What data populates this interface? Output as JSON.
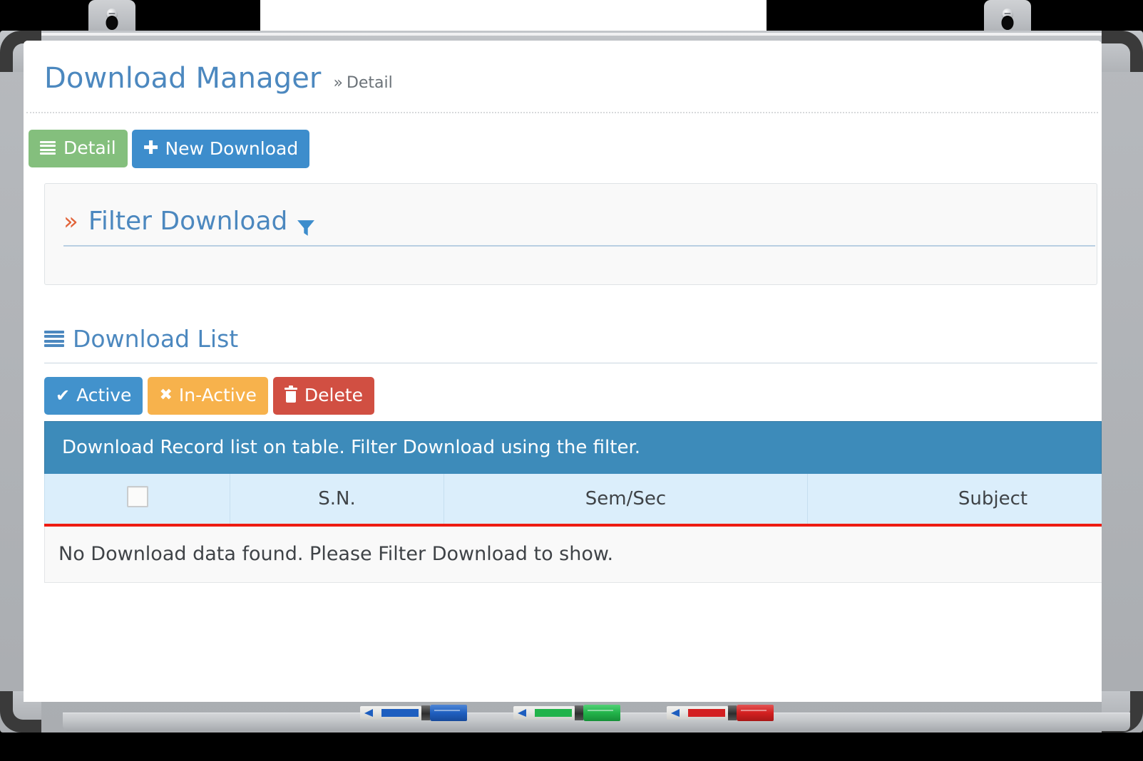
{
  "header": {
    "title": "Download Manager",
    "breadcrumb_chevron": "»",
    "breadcrumb": "Detail"
  },
  "toolbar": {
    "detail_label": "Detail",
    "detail_icon": "list-icon",
    "detail_color": "#84bf7d",
    "new_download_label": "New Download",
    "new_download_icon": "plus-icon",
    "new_download_color": "#3d8dcc"
  },
  "filter_panel": {
    "chevron": "»",
    "title": "Filter Download",
    "icon": "funnel-icon",
    "title_color": "#4c88bf",
    "chevron_color": "#e2643a"
  },
  "list_section": {
    "heading": "Download List",
    "heading_icon": "list-icon",
    "actions": [
      {
        "label": "Active",
        "icon": "check-icon",
        "color": "#4292cc"
      },
      {
        "label": "In-Active",
        "icon": "x-icon",
        "color": "#f7b24c"
      },
      {
        "label": "Delete",
        "icon": "trash-icon",
        "color": "#d14f42"
      }
    ],
    "info_bar": "Download Record list on table. Filter Download using the filter.",
    "info_bar_color": "#3d8bba"
  },
  "table": {
    "select_all_checkbox_checked": false,
    "columns": [
      "",
      "S.N.",
      "Sem/Sec",
      "Subject"
    ],
    "rows": [],
    "empty_message": "No Download data found. Please Filter Download to show.",
    "header_accent_color": "#ee1c12",
    "header_bg_color": "#dbeefb"
  },
  "whiteboard": {
    "markers": [
      {
        "name": "blue-marker",
        "color": "#1f5fbf"
      },
      {
        "name": "green-marker",
        "color": "#22b34a"
      },
      {
        "name": "red-marker",
        "color": "#d32020"
      }
    ]
  }
}
